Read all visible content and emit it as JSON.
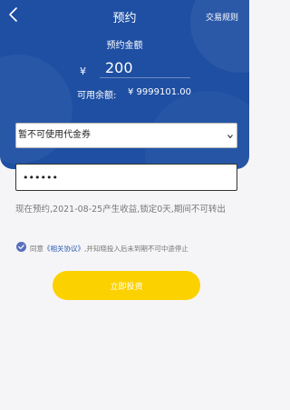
{
  "header": {
    "title": "预约",
    "rules_label": "交易规则"
  },
  "amount": {
    "label": "预约金额",
    "currency_symbol": "¥",
    "value": "200"
  },
  "balance": {
    "label": "可用余额:",
    "value": "¥ 9999101.00"
  },
  "coupon": {
    "selected": "暂不可使用代金券"
  },
  "password": {
    "value": "••••••"
  },
  "notice": {
    "text": "现在预约,2021-08-25产生收益,锁定0天,期间不可转出"
  },
  "agreement": {
    "prefix": "同意",
    "link_text": "《相关协议》",
    "suffix": ",并知晓投入后未到期不可中途停止",
    "checked": true
  },
  "actions": {
    "invest_label": "立即投资"
  },
  "colors": {
    "primary": "#1e4fa3",
    "button": "#fcd100",
    "link": "#2a5bb0"
  },
  "icons": {
    "back": "back-icon",
    "dropdown": "chevron-down-icon",
    "checkbox": "check-icon"
  }
}
